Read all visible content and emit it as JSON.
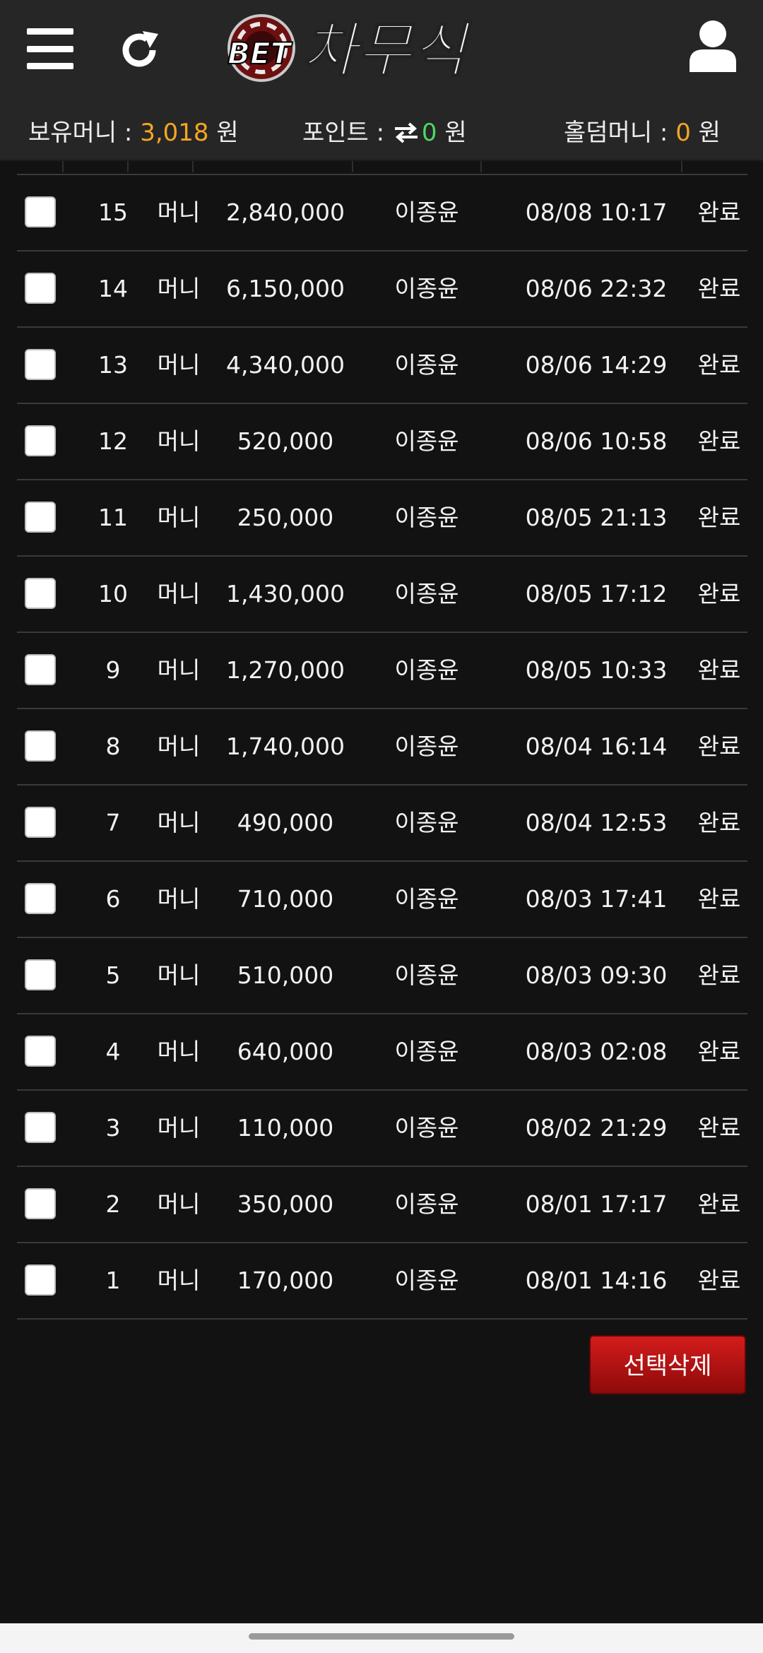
{
  "header": {
    "logo_small": "BET",
    "logo_main": "차무식",
    "menu_icon": "hamburger-menu-icon",
    "refresh_icon": "refresh-icon",
    "user_icon": "user-icon"
  },
  "moneybar": {
    "held_label": "보유머니 : ",
    "held_value": "3,018",
    "held_unit": " 원",
    "point_label": "포인트 : ",
    "point_value": "0",
    "point_unit": " 원",
    "holdem_label": "홀덤머니 : ",
    "holdem_value": "0",
    "holdem_unit": " 원"
  },
  "rows": [
    {
      "no": "15",
      "type": "머니",
      "amount": "2,840,000",
      "name": "이종윤",
      "date": "08/08 10:17",
      "status": "완료"
    },
    {
      "no": "14",
      "type": "머니",
      "amount": "6,150,000",
      "name": "이종윤",
      "date": "08/06 22:32",
      "status": "완료"
    },
    {
      "no": "13",
      "type": "머니",
      "amount": "4,340,000",
      "name": "이종윤",
      "date": "08/06 14:29",
      "status": "완료"
    },
    {
      "no": "12",
      "type": "머니",
      "amount": "520,000",
      "name": "이종윤",
      "date": "08/06 10:58",
      "status": "완료"
    },
    {
      "no": "11",
      "type": "머니",
      "amount": "250,000",
      "name": "이종윤",
      "date": "08/05 21:13",
      "status": "완료"
    },
    {
      "no": "10",
      "type": "머니",
      "amount": "1,430,000",
      "name": "이종윤",
      "date": "08/05 17:12",
      "status": "완료"
    },
    {
      "no": "9",
      "type": "머니",
      "amount": "1,270,000",
      "name": "이종윤",
      "date": "08/05 10:33",
      "status": "완료"
    },
    {
      "no": "8",
      "type": "머니",
      "amount": "1,740,000",
      "name": "이종윤",
      "date": "08/04 16:14",
      "status": "완료"
    },
    {
      "no": "7",
      "type": "머니",
      "amount": "490,000",
      "name": "이종윤",
      "date": "08/04 12:53",
      "status": "완료"
    },
    {
      "no": "6",
      "type": "머니",
      "amount": "710,000",
      "name": "이종윤",
      "date": "08/03 17:41",
      "status": "완료"
    },
    {
      "no": "5",
      "type": "머니",
      "amount": "510,000",
      "name": "이종윤",
      "date": "08/03 09:30",
      "status": "완료"
    },
    {
      "no": "4",
      "type": "머니",
      "amount": "640,000",
      "name": "이종윤",
      "date": "08/03 02:08",
      "status": "완료"
    },
    {
      "no": "3",
      "type": "머니",
      "amount": "110,000",
      "name": "이종윤",
      "date": "08/02 21:29",
      "status": "완료"
    },
    {
      "no": "2",
      "type": "머니",
      "amount": "350,000",
      "name": "이종윤",
      "date": "08/01 17:17",
      "status": "완료"
    },
    {
      "no": "1",
      "type": "머니",
      "amount": "170,000",
      "name": "이종윤",
      "date": "08/01 14:16",
      "status": "완료"
    }
  ],
  "actions": {
    "delete_selected": "선택삭제"
  },
  "colors": {
    "background": "#121212",
    "header": "#262626",
    "accent_orange": "#f5a623",
    "accent_green": "#4cd964",
    "delete_red": "#b81414"
  }
}
